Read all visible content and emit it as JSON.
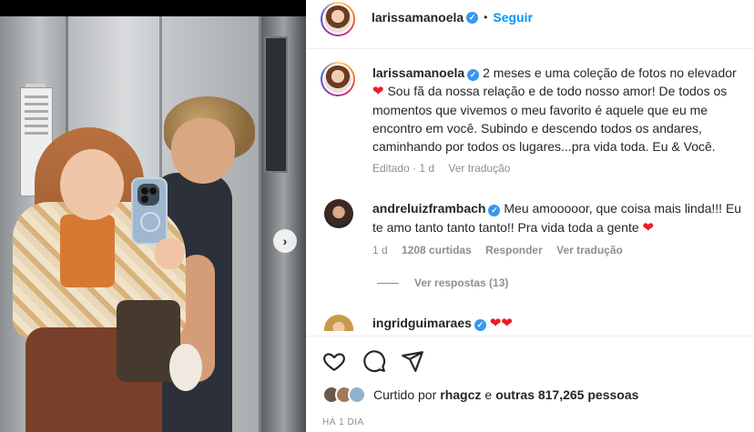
{
  "post": {
    "author": "larissamanoela",
    "follow_label": "Seguir",
    "dot": "•"
  },
  "caption": {
    "author": "larissamanoela",
    "text_before_heart": "2 meses e uma coleção de fotos no elevador",
    "text_after_heart": "Sou fã da nossa relação e de todo nosso amor! De todos os momentos que vivemos o meu favorito é aquele que eu me encontro em você. Subindo e descendo todos os andares, caminhando por todos os lugares...pra vida toda. Eu & Você.",
    "edited": "Editado · 1 d",
    "see_translation": "Ver tradução"
  },
  "comments": [
    {
      "author": "andreluizframbach",
      "text": "Meu amooooor, que coisa mais linda!!! Eu te amo tanto tanto tanto!! Pra vida toda a gente",
      "age": "1 d",
      "likes": "1208 curtidas",
      "reply": "Responder",
      "see_translation": "Ver tradução",
      "view_replies": "Ver respostas (13)"
    },
    {
      "author": "ingridguimaraes"
    }
  ],
  "likes": {
    "prefix": "Curtido por",
    "user": "rhagcz",
    "middle": "e",
    "others": "outras 817,265 pessoas"
  },
  "timestamp": "HÁ 1 DIA",
  "colors": {
    "link_blue": "#0095f6",
    "verified_blue": "#3897f0",
    "heart_red": "#ed1c24",
    "muted_gray": "#8e8e8e"
  }
}
